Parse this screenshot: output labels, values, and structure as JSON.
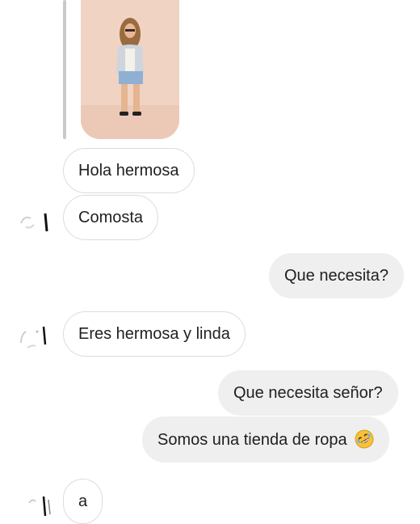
{
  "conversation": {
    "shared_image": {
      "description_icon": "woman-photo"
    },
    "messages": [
      {
        "id": "m1",
        "side": "incoming",
        "text": "Hola hermosa"
      },
      {
        "id": "m2",
        "side": "incoming",
        "text": "Comosta"
      },
      {
        "id": "m3",
        "side": "outgoing",
        "text": "Que necesita?"
      },
      {
        "id": "m4",
        "side": "incoming",
        "text": "Eres hermosa y linda"
      },
      {
        "id": "m5",
        "side": "outgoing",
        "text": "Que necesita señor?"
      },
      {
        "id": "m6",
        "side": "outgoing",
        "text": "Somos una tienda de ropa",
        "emoji": "rolling-on-floor-laughing-emoji"
      },
      {
        "id": "m7",
        "side": "incoming",
        "text": "a"
      }
    ]
  },
  "colors": {
    "background": "#ffffff",
    "incoming_bubble_border": "#dcdcdc",
    "outgoing_bubble_fill": "#efefef",
    "text": "#1f1f1f",
    "photo_background": "#f0d3c3"
  }
}
